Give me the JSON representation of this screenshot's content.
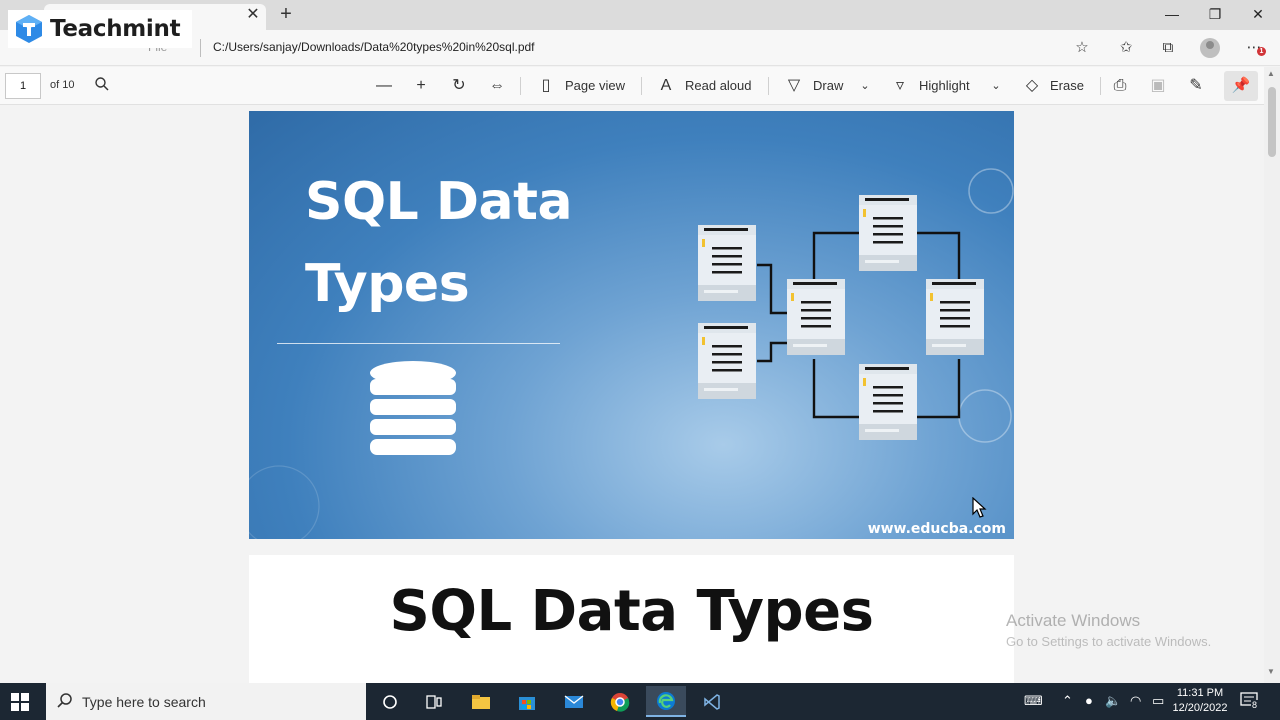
{
  "brand": {
    "name": "Teachmint"
  },
  "titlebar": {
    "tab_close": "✕",
    "new_tab": "+",
    "minimize": "—",
    "restore": "❐",
    "close": "✕"
  },
  "address": {
    "info_label": "File",
    "url": "C:/Users/sanjay/Downloads/Data%20types%20in%20sql.pdf",
    "notification_count": "1"
  },
  "pdf_toolbar": {
    "page_number": "1",
    "page_count": "of 10",
    "page_view": "Page view",
    "read_aloud": "Read aloud",
    "draw": "Draw",
    "highlight": "Highlight",
    "erase": "Erase"
  },
  "slide": {
    "title_line1": "SQL Data",
    "title_line2": "Types",
    "footer_url": "www.educba.com"
  },
  "page2": {
    "title": "SQL Data Types"
  },
  "watermark": {
    "title": "Activate Windows",
    "subtitle": "Go to Settings to activate Windows."
  },
  "taskbar": {
    "search_placeholder": "Type here to search",
    "time": "11:31 PM",
    "date": "12/20/2022",
    "notification_badge": "8"
  },
  "colors": {
    "slide_blue": "#3f80bd",
    "taskbar": "#1c2733",
    "edge_accent": "#0c7bd4"
  }
}
